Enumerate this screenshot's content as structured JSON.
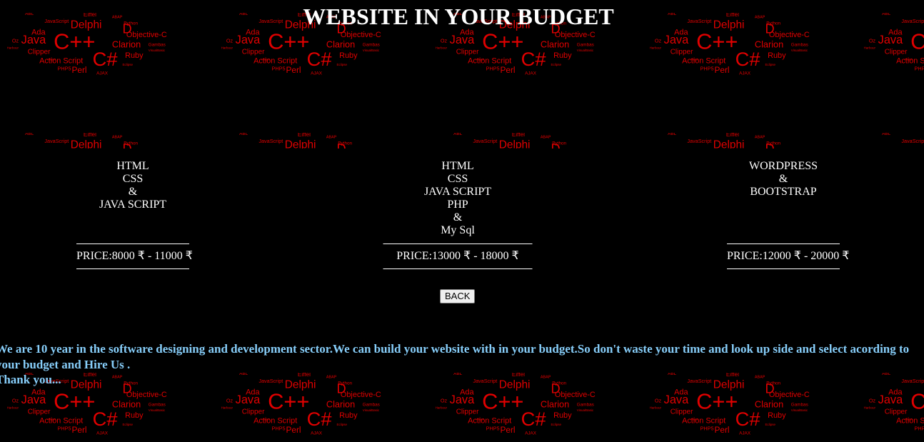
{
  "header": {
    "title": "WEBSITE IN YOUR BUDGET"
  },
  "background": {
    "image": "programming-languages-word-cloud",
    "color": "#000000",
    "word_color": "#e00000",
    "words": [
      "ABL",
      "Eiffel",
      "ABAP",
      "JavaScript",
      "Delphi",
      "D",
      "Python",
      "Ada",
      "Java",
      "C++",
      "Objective-C",
      "Oz",
      "Harbour",
      "Clarion",
      "Gambas",
      "Clipper",
      "C#",
      "Ruby",
      "Action Script",
      "PHP5",
      "Perl",
      "AJAX",
      "VBNET",
      "VisualBasic",
      "Eclipse"
    ]
  },
  "packages": [
    {
      "tech": [
        "HTML",
        "CSS",
        "&",
        "JAVA SCRIPT"
      ],
      "price": "PRICE:8000 ₹ - 11000 ₹"
    },
    {
      "tech": [
        "HTML",
        "CSS",
        "JAVA SCRIPT",
        "PHP",
        "&",
        "My Sql"
      ],
      "price": "PRICE:13000 ₹ - 18000 ₹"
    },
    {
      "tech": [
        "WORDPRESS",
        "&",
        "BOOTSTRAP"
      ],
      "price": "PRICE:12000 ₹ - 20000 ₹"
    }
  ],
  "actions": {
    "back_label": "BACK"
  },
  "about": {
    "text": "We are 10 year in the software designing and development sector.We can build your website with in your budget.So don't waste your time and look up side and select acording to your budget and Hire Us .",
    "thanks": "Thank you..."
  },
  "colors": {
    "text": "#ffffff",
    "about_text": "#87cefa",
    "accent": "#e00000"
  }
}
